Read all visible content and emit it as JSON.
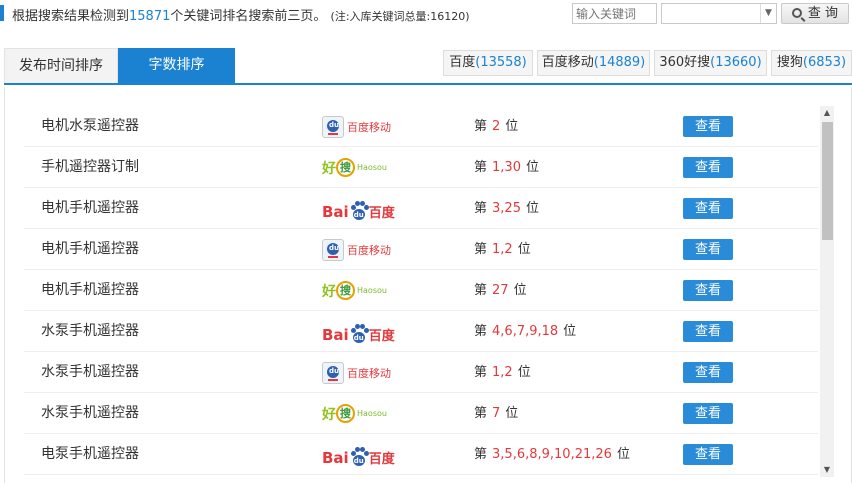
{
  "header": {
    "summary_prefix": "根据搜索结果检测到",
    "keyword_count": "15871",
    "summary_suffix": "个关键词排名搜索前三页。",
    "note": "(注:入库关键词总量:16120)",
    "search_placeholder": "输入关键词",
    "select_value": "",
    "query_label": "查 询"
  },
  "tabs": [
    {
      "label": "发布时间排序",
      "active": false
    },
    {
      "label": "字数排序",
      "active": true
    }
  ],
  "engines": [
    {
      "name": "百度",
      "count": "(13558)"
    },
    {
      "name": "百度移动",
      "count": "(14889)"
    },
    {
      "name": "360好搜",
      "count": "(13660)"
    },
    {
      "name": "搜狗",
      "count": "(6853)"
    }
  ],
  "rank_prefix": "第",
  "rank_suffix": "位",
  "view_label": "查看",
  "logos": {
    "baidu_mobile_text": "百度移动",
    "haosou_text": "好",
    "haosou_circle": "搜",
    "haosou_en": "Haosou",
    "baidu_bai": "Bai",
    "baidu_du": "du",
    "baidu_cn": "百度"
  },
  "rows": [
    {
      "keyword": "电机水泵遥控器",
      "engine": "baidu-mobile",
      "positions": "2"
    },
    {
      "keyword": "手机遥控器订制",
      "engine": "haosou",
      "positions": "1,30"
    },
    {
      "keyword": "电机手机遥控器",
      "engine": "baidu",
      "positions": "3,25"
    },
    {
      "keyword": "电机手机遥控器",
      "engine": "baidu-mobile",
      "positions": "1,2"
    },
    {
      "keyword": "电机手机遥控器",
      "engine": "haosou",
      "positions": "27"
    },
    {
      "keyword": "水泵手机遥控器",
      "engine": "baidu",
      "positions": "4,6,7,9,18"
    },
    {
      "keyword": "水泵手机遥控器",
      "engine": "baidu-mobile",
      "positions": "1,2"
    },
    {
      "keyword": "水泵手机遥控器",
      "engine": "haosou",
      "positions": "7"
    },
    {
      "keyword": "电泵手机遥控器",
      "engine": "baidu",
      "positions": "3,5,6,8,9,10,21,26"
    }
  ],
  "colors": {
    "accent": "#1b82d2",
    "rank": "#e4393c",
    "button": "#2a8bd8"
  }
}
